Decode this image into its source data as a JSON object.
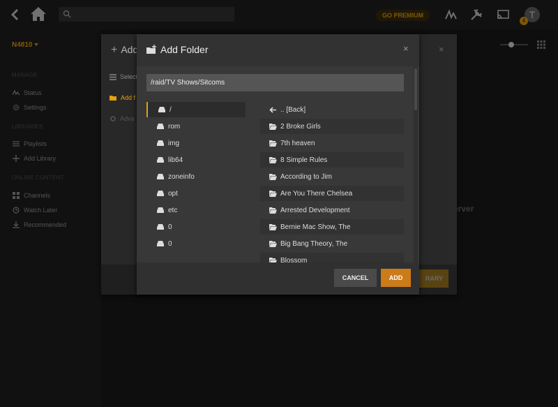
{
  "topbar": {
    "premium_label": "GO PREMIUM",
    "avatar_letter": "T",
    "notification_count": "4"
  },
  "sidebar": {
    "server_name": "N4810",
    "sections": {
      "manage": "MANAGE",
      "libraries": "LIBRARIES",
      "online": "ONLINE CONTENT"
    },
    "items": [
      {
        "label": "Status",
        "icon": "pulse-icon"
      },
      {
        "label": "Settings",
        "icon": "gear-icon"
      },
      {
        "label": "Playlists",
        "icon": "list-icon"
      },
      {
        "label": "Add Library",
        "icon": "plus-icon"
      },
      {
        "label": "Channels",
        "icon": "grid-icon"
      },
      {
        "label": "Watch Later",
        "icon": "clock-icon"
      },
      {
        "label": "Recommended",
        "icon": "download-icon"
      }
    ]
  },
  "background_modal": {
    "title": "Add",
    "items": [
      "Select",
      "Add f",
      "Adva"
    ],
    "button_fragment": "RARY"
  },
  "background_text": "erver",
  "modal": {
    "title": "Add Folder",
    "close": "×",
    "path_value": "/raid/TV Shows/Sitcoms",
    "roots": [
      "/",
      "rom",
      "img",
      "lib64",
      "zoneinfo",
      "opt",
      "etc",
      "0",
      "0"
    ],
    "back_label": ".. [Back]",
    "directories": [
      "2 Broke Girls",
      "7th heaven",
      "8 Simple Rules",
      "According to Jim",
      "Are You There Chelsea",
      "Arrested Development",
      "Bernie Mac Show, The",
      "Big Bang Theory, The",
      "Blossom"
    ],
    "cancel_label": "CANCEL",
    "add_label": "ADD"
  },
  "colors": {
    "accent": "#e5a00d",
    "button_add": "#cc7b19"
  }
}
